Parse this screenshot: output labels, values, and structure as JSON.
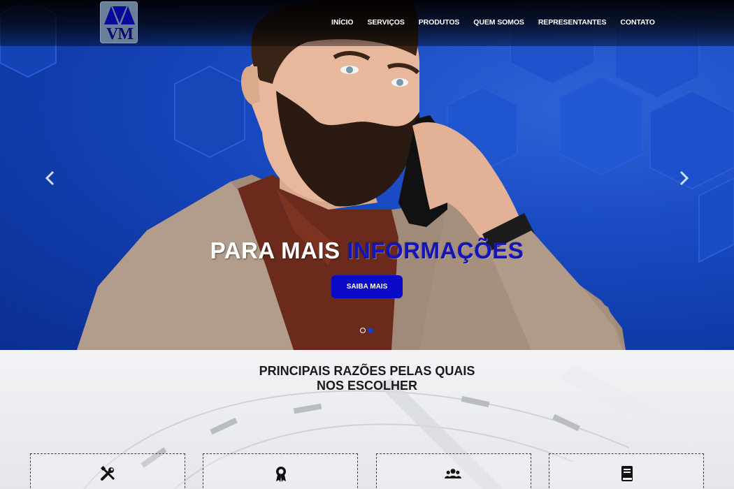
{
  "brand": {
    "logo_text": "VM"
  },
  "nav": {
    "items": [
      "INÍCIO",
      "SERVIÇOS",
      "PRODUTOS",
      "QUEM SOMOS",
      "REPRESENTANTES",
      "CONTATO"
    ]
  },
  "hero": {
    "headline_white": "PARA MAIS",
    "headline_blue": "INFORMAÇÕES",
    "cta_label": "SAIBA MAIS",
    "slide_count": 2,
    "active_slide": 2
  },
  "reasons": {
    "title_line1": "PRINCIPAIS RAZÕES PELAS QUAIS",
    "title_line2": "NOS ESCOLHER",
    "cards": [
      {
        "icon": "tools-icon"
      },
      {
        "icon": "award-icon"
      },
      {
        "icon": "users-icon"
      },
      {
        "icon": "book-icon"
      }
    ]
  },
  "colors": {
    "accent": "#0a0ac8",
    "hero_bg": "#1a4bc4",
    "headline_blue": "#1414b8"
  }
}
